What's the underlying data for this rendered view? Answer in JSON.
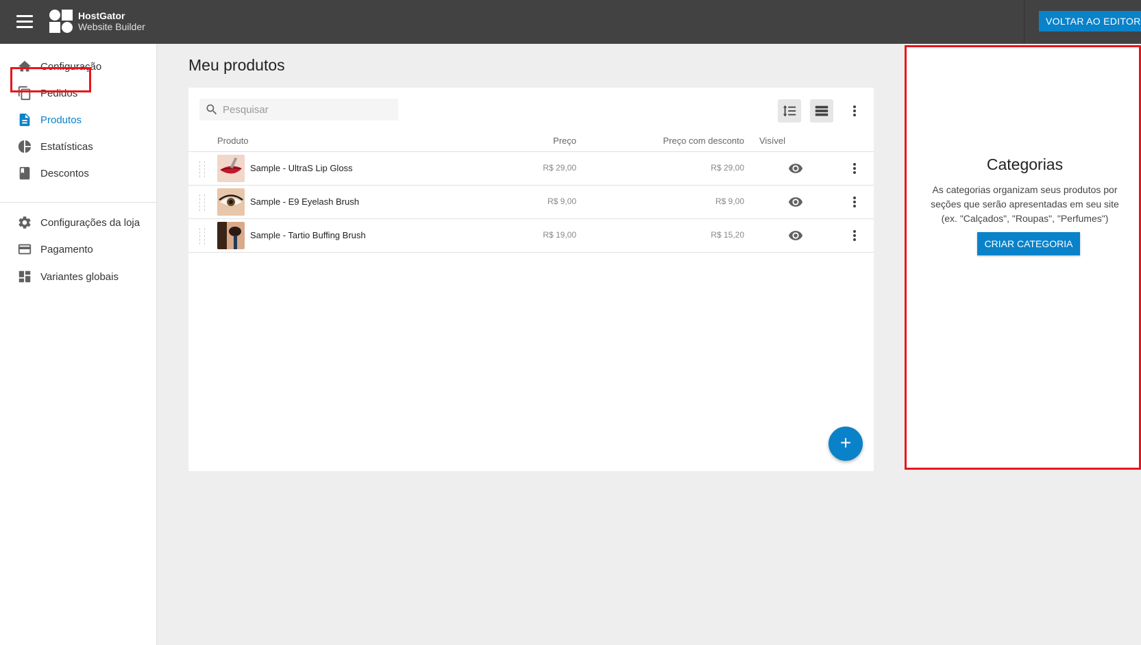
{
  "header": {
    "brand_line1": "HostGator",
    "brand_line2": "Website Builder",
    "back_button": "VOLTAR AO EDITOR"
  },
  "sidebar": {
    "items": [
      {
        "label": "Configuração",
        "icon": "home-icon"
      },
      {
        "label": "Pedidos",
        "icon": "copy-icon"
      },
      {
        "label": "Produtos",
        "icon": "document-icon",
        "active": true
      },
      {
        "label": "Estatísticas",
        "icon": "pie-chart-icon"
      },
      {
        "label": "Descontos",
        "icon": "book-icon"
      },
      {
        "label": "Configurações da loja",
        "icon": "gear-icon"
      },
      {
        "label": "Pagamento",
        "icon": "credit-card-icon"
      },
      {
        "label": "Variantes globais",
        "icon": "dashboard-icon"
      }
    ]
  },
  "main": {
    "title": "Meu produtos",
    "search_placeholder": "Pesquisar",
    "columns": {
      "product": "Produto",
      "price": "Preço",
      "discount_price": "Preço com desconto",
      "visible": "Visível"
    },
    "products": [
      {
        "name": "Sample - UltraS Lip Gloss",
        "price": "R$ 29,00",
        "discount_price": "R$ 29,00"
      },
      {
        "name": "Sample - E9 Eyelash Brush",
        "price": "R$ 9,00",
        "discount_price": "R$ 9,00"
      },
      {
        "name": "Sample - Tartio Buffing Brush",
        "price": "R$ 19,00",
        "discount_price": "R$ 15,20"
      }
    ],
    "fab_label": "+"
  },
  "categories": {
    "title": "Categorias",
    "description": "As categorias organizam seus produtos por seções que serão apresentadas em seu site (ex. \"Calçados\", \"Roupas\", \"Perfumes\")",
    "button": "CRIAR CATEGORIA"
  },
  "colors": {
    "accent": "#0a82c9",
    "topbar": "#424242",
    "highlight": "#e8141c"
  }
}
